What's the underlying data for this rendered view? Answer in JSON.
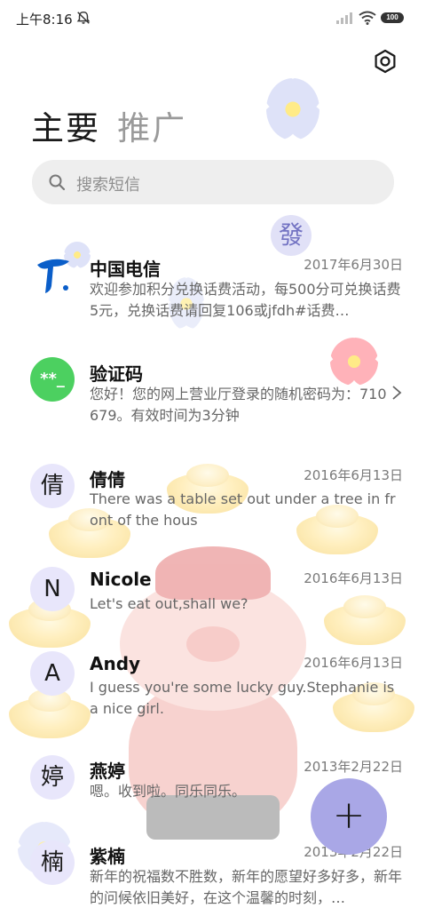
{
  "status_bar": {
    "time": "上午8:16",
    "battery": "100"
  },
  "header": {
    "tabs": [
      {
        "label": "主要",
        "active": true
      },
      {
        "label": "推广",
        "active": false
      }
    ]
  },
  "search": {
    "placeholder": "搜索短信"
  },
  "conversations": [
    {
      "name": "中国电信",
      "date": "2017年6月30日",
      "preview": "欢迎参加积分兑换话费活动，每500分可兑换话费5元，兑换话费请回复106或jfdh#话费…",
      "avatar": "telecom-logo"
    },
    {
      "name": "验证码",
      "date": "",
      "preview": "您好！您的网上营业厅登录的随机密码为：710679。有效时间为3分钟",
      "avatar": "**_"
    },
    {
      "name": "倩倩",
      "date": "2016年6月13日",
      "preview": "There was a table set out under a tree in front of the hous",
      "avatar": "倩"
    },
    {
      "name": "Nicole",
      "date": "2016年6月13日",
      "preview": "Let's eat out,shall we?",
      "avatar": "N"
    },
    {
      "name": "Andy",
      "date": "2016年6月13日",
      "preview": "I guess you're some lucky guy.Stephanie is a nice girl.",
      "avatar": "A"
    },
    {
      "name": "燕婷",
      "date": "2013年2月22日",
      "preview": "嗯。收到啦。同乐同乐。",
      "avatar": "婷"
    },
    {
      "name": "紫楠",
      "date": "2013年2月22日",
      "preview": "新年的祝福数不胜数，新年的愿望好多好多，新年的问候依旧美好，在这个温馨的时刻，…",
      "avatar": "楠"
    }
  ],
  "decor": {
    "badge_text": "發"
  },
  "fab": {
    "label": "+"
  },
  "colors": {
    "avatar_bg": "#e8e6fb",
    "verify_green": "#4cd060",
    "fab_bg": "#a9a7e6",
    "search_bg": "#eeeeee",
    "telecom_blue": "#0a5ec9"
  }
}
